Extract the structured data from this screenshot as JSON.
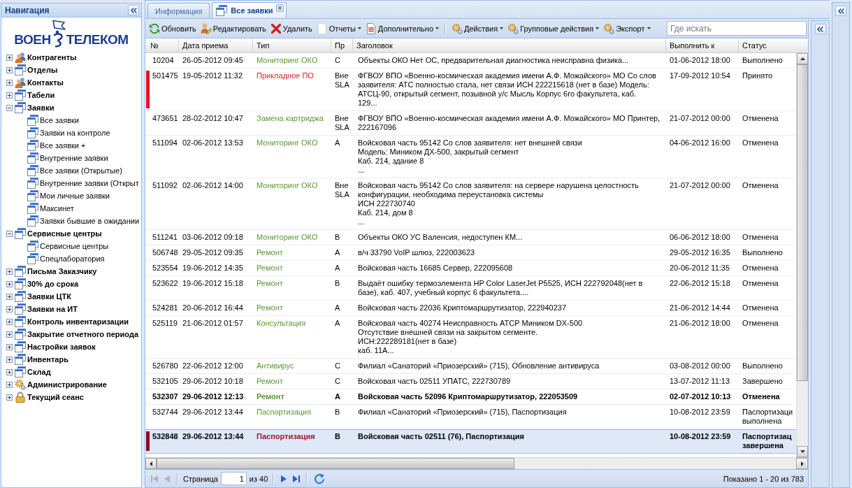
{
  "navigation": {
    "title": "Навигация",
    "logo": {
      "left": "ВОЕН",
      "right": "ТЕЛЕКОМ"
    },
    "tree": [
      {
        "label": "Контрагенты",
        "kind": "people",
        "expanded": false
      },
      {
        "label": "Отделы",
        "kind": "window",
        "expanded": false
      },
      {
        "label": "Контакты",
        "kind": "people",
        "expanded": false
      },
      {
        "label": "Табели",
        "kind": "window",
        "expanded": false
      },
      {
        "label": "Заявки",
        "kind": "window",
        "expanded": true,
        "children": [
          {
            "label": "Все заявки",
            "kind": "window"
          },
          {
            "label": "Заявки на контроле",
            "kind": "window"
          },
          {
            "label": "Все заявки +",
            "kind": "window"
          },
          {
            "label": "Внутренние заявки",
            "kind": "window"
          },
          {
            "label": "Все заявки (Открытые)",
            "kind": "window"
          },
          {
            "label": "Внутренние заявки (Открыт",
            "kind": "window"
          },
          {
            "label": "Мои личные заявки",
            "kind": "window"
          },
          {
            "label": "Максинет",
            "kind": "window"
          },
          {
            "label": "Заявки бывшие в ожидании",
            "kind": "window"
          }
        ]
      },
      {
        "label": "Сервисные центры",
        "kind": "window",
        "expanded": true,
        "children": [
          {
            "label": "Сервисные центры",
            "kind": "window"
          },
          {
            "label": "Спецлаборатория",
            "kind": "window"
          }
        ]
      },
      {
        "label": "Письма Заказчику",
        "kind": "window",
        "expanded": false
      },
      {
        "label": "30% до срока",
        "kind": "window",
        "expanded": false
      },
      {
        "label": "Заявки ЦТК",
        "kind": "window",
        "expanded": false
      },
      {
        "label": "Заявки на ИТ",
        "kind": "window",
        "expanded": false
      },
      {
        "label": "Контроль инвентаризации",
        "kind": "window",
        "expanded": false
      },
      {
        "label": "Закрытие отчетного периода",
        "kind": "window",
        "expanded": false
      },
      {
        "label": "Настройки заявок",
        "kind": "window",
        "expanded": false
      },
      {
        "label": "Инвентарь",
        "kind": "window",
        "expanded": false
      },
      {
        "label": "Склад",
        "kind": "window",
        "expanded": false
      },
      {
        "label": "Администрирование",
        "kind": "gears",
        "expanded": false
      },
      {
        "label": "Текущий сеанс",
        "kind": "lock",
        "expanded": false
      }
    ]
  },
  "tabs": [
    {
      "label": "Информация",
      "selected": false,
      "icon": false,
      "closable": false
    },
    {
      "label": "Все заявки",
      "selected": true,
      "icon": true,
      "closable": true
    }
  ],
  "toolbar": {
    "groups": [
      [
        {
          "label": "Обновить",
          "kind": "refresh",
          "menu": false
        },
        {
          "label": "Редактировать",
          "kind": "edit",
          "menu": false
        },
        {
          "label": "Удалить",
          "kind": "delete",
          "menu": false
        },
        {
          "label": "Отчеты",
          "kind": "report",
          "menu": true
        },
        {
          "label": "Дополнительно",
          "kind": "extra",
          "menu": true
        }
      ],
      [
        {
          "label": "Действия",
          "kind": "gears",
          "menu": true
        },
        {
          "label": "Групповые действия",
          "kind": "gears",
          "menu": true
        },
        {
          "label": "Экспорт",
          "kind": "gears",
          "menu": true
        }
      ]
    ],
    "search": {
      "placeholder": "Где искать"
    }
  },
  "grid": {
    "columns": [
      "№",
      "Дата приема",
      "Тип",
      "Пр",
      "Заголовок",
      "Выполнить к",
      "Статус"
    ],
    "rows": [
      {
        "number": "10204",
        "received": "26-05-2012 09:45",
        "type": "Мониторинг ОКО",
        "color": "#5b9632",
        "priority": "C",
        "title": "Объекты ОКО Нет ОС, предварительная диагностика неисправна физика...",
        "due": "01-06-2012 18:00",
        "status": "Выполнено",
        "bold": false,
        "selected": false
      },
      {
        "number": "501475",
        "received": "19-05-2012 11:32",
        "type": "Прикладное ПО",
        "color": "#e0201e",
        "priority": "Вне SLA",
        "title": "ФГВОУ ВПО «Военно-космическая академия имени А.Ф. Можайского» МО Со слов\nзаявителя: АТС полностью стала, нет связи ИСН 222215618 (нет в базе) Модель:\nАТСЦ-90, открытый сегмент, позывной у/с Мысль Корпус 6го факультета, каб.\n129...",
        "due": "17-09-2012 10:54",
        "status": "Принято",
        "bold": false,
        "selected": false,
        "flag": {
          "color": "#e8141c"
        }
      },
      {
        "number": "473651",
        "received": "28-02-2012 10:47",
        "type": "Замена картриджа",
        "color": "#5b9632",
        "priority": "Вне SLA",
        "title": "ФГВОУ ВПО «Военно-космическая академия имени А.Ф. Можайского» МО Принтер,\n222167096",
        "due": "21-07-2012 00:00",
        "status": "Отменена",
        "bold": false,
        "selected": false
      },
      {
        "number": "511094",
        "received": "02-06-2012 13:53",
        "type": "Мониторинг ОКО",
        "color": "#5b9632",
        "priority": "A",
        "title": "Войсковая часть 95142 Со слов заявителя: нет внешней связи\nМодель: Миником ДХ-500, закрытый сегмент\nКаб. 214, здание 8\n...",
        "due": "04-06-2012 16:00",
        "status": "Отменена",
        "bold": false,
        "selected": false
      },
      {
        "number": "511092",
        "received": "02-06-2012 14:00",
        "type": "Мониторинг ОКО",
        "color": "#5b9632",
        "priority": "Вне SLA",
        "title": "Войсковая часть 95142 Со слов заявителя: на сервере нарушена целостность\nконфигурации, необходима переустановка системы\nИСН 222730740\nКаб. 214, дом 8\n...",
        "due": "21-07-2012 00:00",
        "status": "Отменена",
        "bold": false,
        "selected": false
      },
      {
        "number": "511241",
        "received": "03-06-2012 09:18",
        "type": "Мониторинг ОКО",
        "color": "#5b9632",
        "priority": "B",
        "title": "Объекты ОКО УС Валенсия, недоступен КМ...",
        "due": "06-06-2012 18:00",
        "status": "Отменена",
        "bold": false,
        "selected": false
      },
      {
        "number": "506748",
        "received": "29-05-2012 09:35",
        "type": "Ремонт",
        "color": "#5b9632",
        "priority": "A",
        "title": "в/ч 33790 VoIP шлюз, 222003623",
        "due": "29-05-2012 16:35",
        "status": "Выполнено",
        "bold": false,
        "selected": false
      },
      {
        "number": "523554",
        "received": "19-06-2012 14:35",
        "type": "Ремонт",
        "color": "#5b9632",
        "priority": "A",
        "title": "Войсковая часть 16685 Сервер, 222095608",
        "due": "20-06-2012 11:35",
        "status": "Отменена",
        "bold": false,
        "selected": false
      },
      {
        "number": "523622",
        "received": "19-06-2012 15:18",
        "type": "Ремонт",
        "color": "#5b9632",
        "priority": "B",
        "title": "Выдаёт ошибку термоэлемента HP Color LaserJet P5525, ИСН 222792048(нет в\nбазе), каб. 407, учебный корпус 6 факультета....",
        "due": "22-06-2012 15:18",
        "status": "Отменена",
        "bold": false,
        "selected": false
      },
      {
        "number": "524281",
        "received": "20-06-2012 16:44",
        "type": "Ремонт",
        "color": "#5b9632",
        "priority": "A",
        "title": "Войсковая часть 22036 Криптомаршрутизатор, 222940237",
        "due": "21-06-2012 14:44",
        "status": "Отменена",
        "bold": false,
        "selected": false
      },
      {
        "number": "525119",
        "received": "21-06-2012 01:57",
        "type": "Консультация",
        "color": "#5b9632",
        "priority": "A",
        "title": "Войсковая часть 40274 Неисправность АТСР Миником DX-500\nОтсутствие внешней связи на закрытом сегменте.\nИСН:222289181(нет в базе)\nкаб. 11А...",
        "due": "21-06-2012 18:00",
        "status": "Отменена",
        "bold": false,
        "selected": false
      },
      {
        "number": "526780",
        "received": "22-06-2012 12:00",
        "type": "Антивирус",
        "color": "#5b9632",
        "priority": "C",
        "title": "Филиал «Санаторий «Приозерский» (715), Обновление антивируса",
        "due": "03-08-2012 00:00",
        "status": "Выполнено",
        "bold": false,
        "selected": false
      },
      {
        "number": "532105",
        "received": "29-06-2012 10:18",
        "type": "Ремонт",
        "color": "#5b9632",
        "priority": "C",
        "title": "Войсковая часть 02511 УПАТС, 222730789",
        "due": "13-07-2012 11:13",
        "status": "Завершено",
        "bold": false,
        "selected": false
      },
      {
        "number": "532307",
        "received": "29-06-2012 12:13",
        "type": "Ремонт",
        "color": "#5b9632",
        "priority": "A",
        "title": "Войсковая часть 52096 Криптомаршрутизатор, 222053509",
        "due": "02-07-2012 10:13",
        "status": "Отменена",
        "bold": true,
        "selected": false
      },
      {
        "number": "532744",
        "received": "29-06-2012 13:44",
        "type": "Паспортизация",
        "color": "#5b9632",
        "priority": "B",
        "title": "Филиал «Санаторий «Приозерский» (715), Паспортизация",
        "due": "10-08-2012 23:59",
        "status": "Паспортизаци\nвыполнена",
        "bold": false,
        "selected": false
      },
      {
        "number": "532848",
        "received": "29-06-2012 13:44",
        "type": "Паспортизация",
        "color": "#9c1530",
        "priority": "B",
        "title": "Войсковая часть 02511 (76), Паспортизация",
        "due": "10-08-2012 23:59",
        "status": "Паспортизац\nзавершена",
        "bold": true,
        "selected": true,
        "flag": {
          "color": "#8b1020"
        }
      }
    ]
  },
  "paging": {
    "buttons_before": [
      {
        "kind": "first",
        "disabled": true
      },
      {
        "kind": "prev",
        "disabled": true
      }
    ],
    "page_label": "Страница",
    "page": "1",
    "page_count": "из 40",
    "buttons_after": [
      {
        "kind": "next",
        "disabled": false
      },
      {
        "kind": "last",
        "disabled": false
      }
    ],
    "summary": "Показано 1 - 20 из 783"
  }
}
